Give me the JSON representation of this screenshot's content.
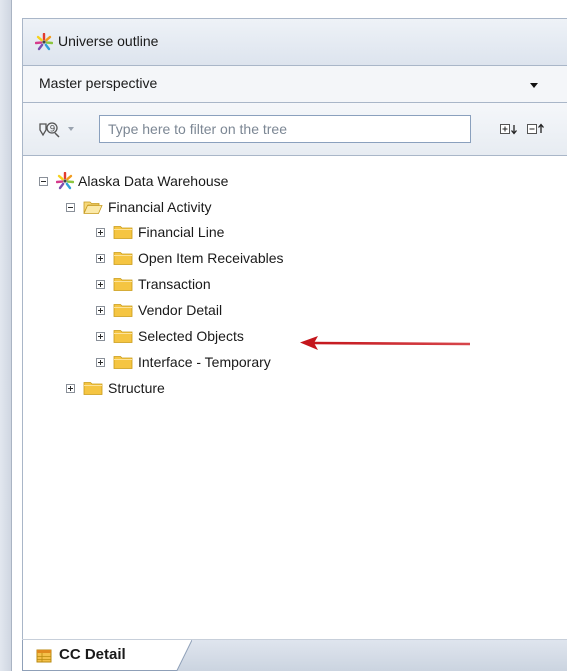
{
  "panel": {
    "title": "Universe outline"
  },
  "perspective": {
    "selected": "Master perspective"
  },
  "toolbar": {
    "search_placeholder": "Type here to filter on the tree"
  },
  "tree": {
    "root": {
      "label": "Alaska Data Warehouse",
      "expanded": true
    },
    "children": [
      {
        "label": "Financial Activity",
        "expanded": true,
        "children": [
          {
            "label": "Financial Line"
          },
          {
            "label": "Open Item Receivables"
          },
          {
            "label": "Transaction"
          },
          {
            "label": "Vendor Detail"
          },
          {
            "label": "Selected Objects"
          },
          {
            "label": "Interface - Temporary"
          }
        ]
      },
      {
        "label": "Structure",
        "expanded": false
      }
    ]
  },
  "annotation": {
    "arrow_color": "#c4161c",
    "points_to": "Selected Objects"
  },
  "bottom_tabs": [
    {
      "label": "CC Detail",
      "active": true
    }
  ],
  "colors": {
    "folder": "#f5c542",
    "border": "#a9b6c8",
    "tab_bg": "#ffffff"
  }
}
